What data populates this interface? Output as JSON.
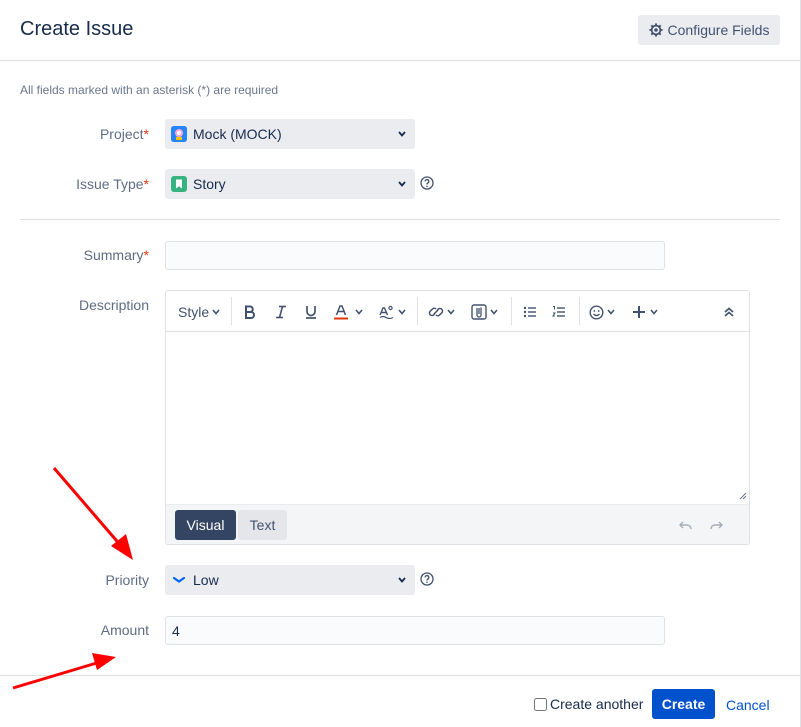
{
  "dialog": {
    "title": "Create Issue",
    "configure_label": "Configure Fields",
    "required_note": "All fields marked with an asterisk (*) are required"
  },
  "fields": {
    "project": {
      "label": "Project",
      "value": "Mock (MOCK)"
    },
    "issue_type": {
      "label": "Issue Type",
      "value": "Story"
    },
    "summary": {
      "label": "Summary",
      "value": ""
    },
    "description": {
      "label": "Description"
    },
    "priority": {
      "label": "Priority",
      "value": "Low"
    },
    "amount": {
      "label": "Amount",
      "value": "4"
    }
  },
  "asterisk": "*",
  "editor": {
    "style_label": "Style",
    "mode_visual": "Visual",
    "mode_text": "Text"
  },
  "footer": {
    "create_another": "Create another",
    "create": "Create",
    "cancel": "Cancel"
  },
  "colors": {
    "primary": "#0052cc",
    "required": "#de350b",
    "story": "#36b37e",
    "project_icon": "#2684ff",
    "annotation_arrow": "#ff0000"
  },
  "icons": [
    "gear-icon",
    "chevron-down-icon",
    "help-icon",
    "bold-icon",
    "italic-icon",
    "underline-icon",
    "text-color-icon",
    "text-format-icon",
    "link-icon",
    "attachment-icon",
    "bullet-list-icon",
    "numbered-list-icon",
    "emoji-icon",
    "plus-icon",
    "collapse-icon",
    "undo-icon",
    "redo-icon",
    "priority-low-icon",
    "story-icon",
    "project-avatar-icon"
  ]
}
